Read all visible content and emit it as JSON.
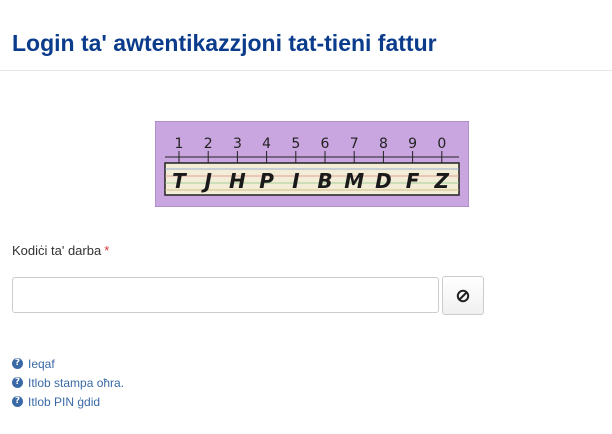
{
  "page": {
    "title": "Login ta' awtentikazzjoni tat-tieni fattur"
  },
  "captcha": {
    "digits": [
      "1",
      "2",
      "3",
      "4",
      "5",
      "6",
      "7",
      "8",
      "9",
      "0"
    ],
    "letters": [
      "T",
      "J",
      "H",
      "P",
      "I",
      "B",
      "M",
      "D",
      "F",
      "Z"
    ],
    "background_color": "#c9a6df"
  },
  "form": {
    "code_label": "Kodiċi ta' darba",
    "required_marker": "*",
    "code_value": "",
    "clear_icon": "ban-icon"
  },
  "links": [
    {
      "label": "Ieqaf",
      "icon": "question-circle-icon"
    },
    {
      "label": "Itlob stampa oħra.",
      "icon": "question-circle-icon"
    },
    {
      "label": "Itlob PIN ġdid",
      "icon": "question-circle-icon"
    }
  ],
  "colors": {
    "title": "#0b3c8c",
    "link": "#3a6aa6",
    "required": "#d9383a"
  }
}
